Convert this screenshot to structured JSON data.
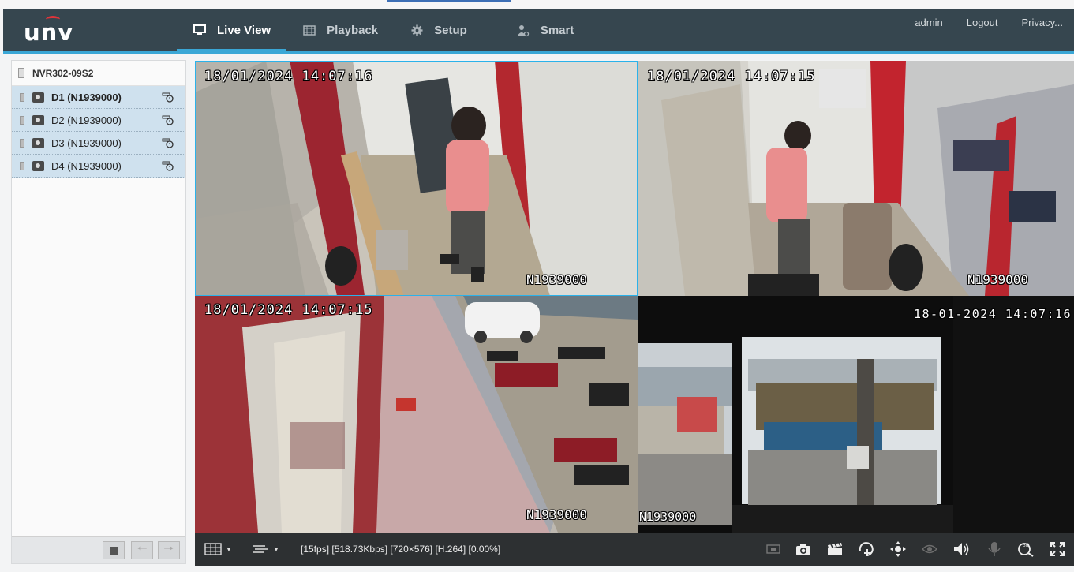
{
  "header": {
    "brand": "unv",
    "nav": [
      {
        "label": "Live View",
        "icon": "monitor-icon",
        "active": true
      },
      {
        "label": "Playback",
        "icon": "film-icon",
        "active": false
      },
      {
        "label": "Setup",
        "icon": "gear-icon",
        "active": false
      },
      {
        "label": "Smart",
        "icon": "smart-person-icon",
        "active": false
      }
    ],
    "links": [
      "admin",
      "Logout",
      "Privacy..."
    ]
  },
  "sidebar": {
    "device": "NVR302-09S2",
    "cameras": [
      {
        "label": "D1 (N1939000)",
        "selected": true
      },
      {
        "label": "D2 (N1939000)",
        "selected": false
      },
      {
        "label": "D3 (N1939000)",
        "selected": false
      },
      {
        "label": "D4 (N1939000)",
        "selected": false
      }
    ]
  },
  "tiles": [
    {
      "time": "18/01/2024  14:07:16",
      "name": "N1939000"
    },
    {
      "time": "18/01/2024  14:07:15",
      "name": "N1939000"
    },
    {
      "time": "18/01/2024  14:07:15",
      "name": "N1939000"
    },
    {
      "time": "18-01-2024  14:07:16",
      "name": "N1939000"
    }
  ],
  "toolbar": {
    "status": "[15fps] [518.73Kbps] [720×576] [H.264] [0.00%]"
  },
  "colors": {
    "header_bg": "#36464f",
    "accent": "#3aa7d6",
    "toolbar_bg": "#2d3032",
    "camera_row_bg": "#cfe1ee"
  }
}
